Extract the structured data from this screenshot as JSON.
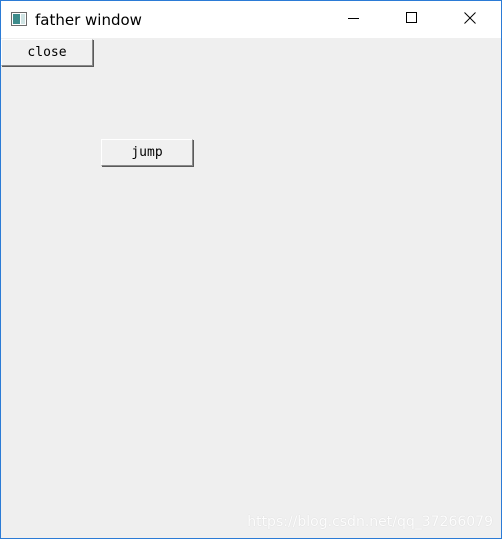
{
  "window": {
    "title": "father window",
    "title_icon": "app-window-icon",
    "caption_buttons": {
      "minimize_icon": "minimize-icon",
      "maximize_icon": "maximize-icon",
      "close_icon": "close-icon"
    },
    "border_color": "#2b7bd6"
  },
  "client": {
    "close_button_label": "close",
    "jump_button_label": "jump",
    "background": "#efefef"
  },
  "watermark": {
    "text": "https://blog.csdn.net/qq_37266079"
  }
}
